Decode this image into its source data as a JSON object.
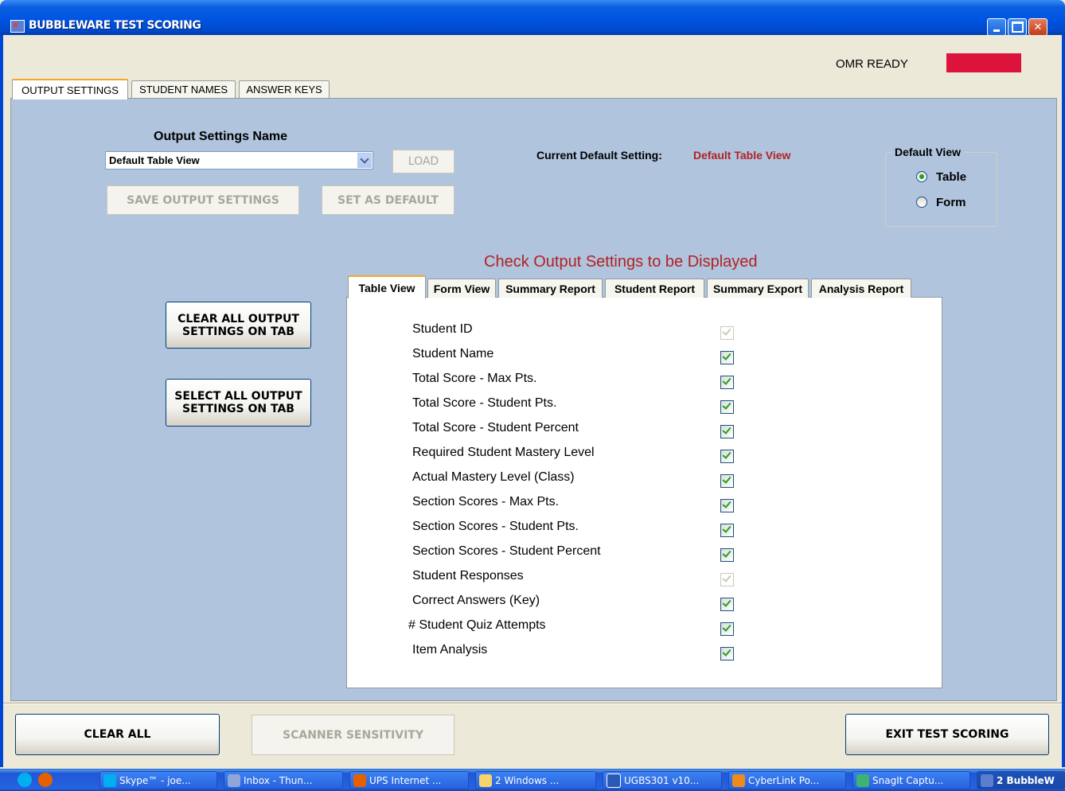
{
  "window": {
    "title": "BUBBLEWARE TEST SCORING"
  },
  "status": {
    "omr_label": "OMR READY",
    "omr_color": "#DC143C"
  },
  "outer_tabs": [
    "OUTPUT SETTINGS",
    "STUDENT NAMES",
    "ANSWER KEYS"
  ],
  "settings": {
    "name_label": "Output Settings Name",
    "selected": "Default Table View",
    "load_label": "LOAD",
    "save_label": "SAVE OUTPUT SETTINGS",
    "set_default_label": "SET AS DEFAULT",
    "current_default_label": "Current Default Setting:",
    "current_default_value": "Default Table View"
  },
  "default_view": {
    "title": "Default View",
    "options": [
      "Table",
      "Form"
    ],
    "selected": "Table"
  },
  "actions": {
    "clear_all_tab": "CLEAR ALL OUTPUT SETTINGS ON TAB",
    "select_all_tab": "SELECT ALL OUTPUT SETTINGS ON TAB"
  },
  "check_header": "Check Output Settings to be Displayed",
  "inner_tabs": [
    "Table View",
    "Form View",
    "Summary Report",
    "Student Report",
    "Summary Export",
    "Analysis Report"
  ],
  "options": [
    {
      "label": "Student ID",
      "checked": true,
      "enabled": false
    },
    {
      "label": "Student Name",
      "checked": true,
      "enabled": true
    },
    {
      "label": "Total Score - Max Pts.",
      "checked": true,
      "enabled": true
    },
    {
      "label": "Total Score - Student Pts.",
      "checked": true,
      "enabled": true
    },
    {
      "label": "Total Score - Student Percent",
      "checked": true,
      "enabled": true
    },
    {
      "label": "Required Student Mastery Level",
      "checked": true,
      "enabled": true
    },
    {
      "label": "Actual Mastery Level (Class)",
      "checked": true,
      "enabled": true
    },
    {
      "label": "Section Scores - Max Pts.",
      "checked": true,
      "enabled": true
    },
    {
      "label": "Section Scores - Student Pts.",
      "checked": true,
      "enabled": true
    },
    {
      "label": "Section Scores - Student Percent",
      "checked": true,
      "enabled": true
    },
    {
      "label": "Student Responses",
      "checked": true,
      "enabled": false
    },
    {
      "label": "Correct Answers (Key)",
      "checked": true,
      "enabled": true
    },
    {
      "label": "# Student Quiz Attempts",
      "checked": true,
      "enabled": true
    },
    {
      "label": "Item Analysis",
      "checked": true,
      "enabled": true
    }
  ],
  "bottom": {
    "clear_all": "CLEAR ALL",
    "scanner": "SCANNER SENSITIVITY",
    "exit": "EXIT TEST SCORING"
  },
  "taskbar": {
    "items": [
      "Skype™ - joe...",
      "Inbox - Thun...",
      "UPS Internet ...",
      "2 Windows ...",
      "UGBS301 v10...",
      "CyberLink Po...",
      "SnagIt Captu...",
      "2 BubbleW"
    ]
  }
}
